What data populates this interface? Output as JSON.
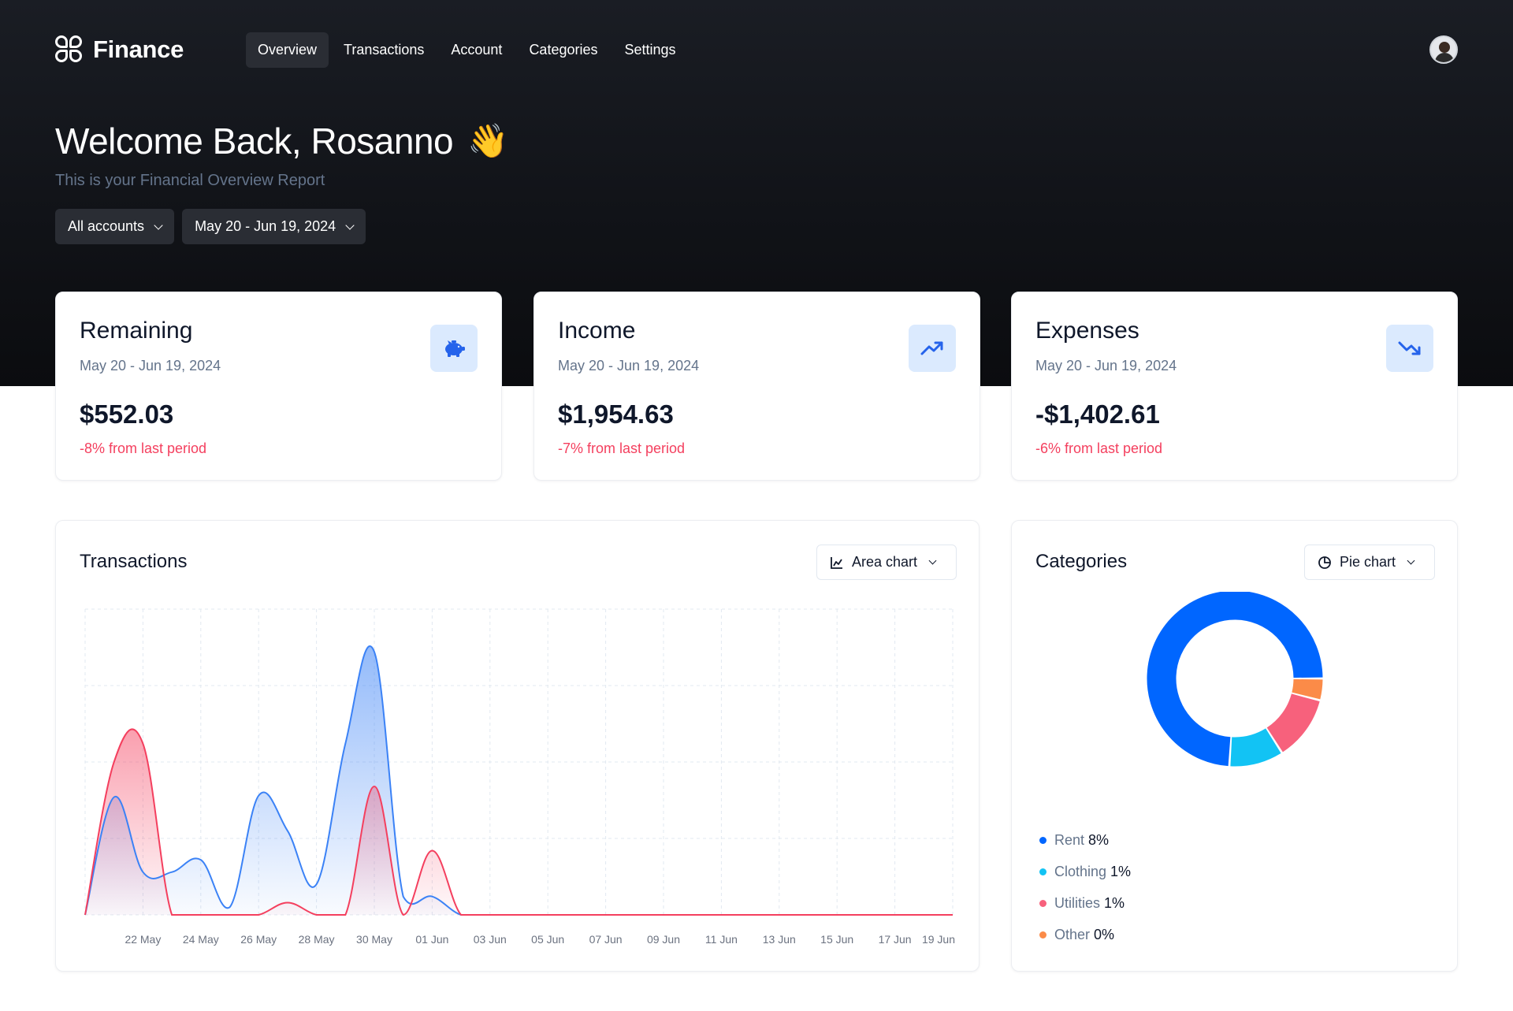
{
  "app": {
    "name": "Finance"
  },
  "nav": {
    "items": [
      {
        "label": "Overview",
        "active": true
      },
      {
        "label": "Transactions",
        "active": false
      },
      {
        "label": "Account",
        "active": false
      },
      {
        "label": "Categories",
        "active": false
      },
      {
        "label": "Settings",
        "active": false
      }
    ]
  },
  "header": {
    "title": "Welcome Back, Rosanno",
    "emoji": "👋",
    "subtitle": "This is your Financial Overview Report"
  },
  "filters": {
    "account": "All accounts",
    "date_range": "May 20 - Jun 19, 2024"
  },
  "stats": [
    {
      "title": "Remaining",
      "range": "May 20 - Jun 19, 2024",
      "value": "$552.03",
      "change": "-8% from last period",
      "icon": "piggy-bank-icon"
    },
    {
      "title": "Income",
      "range": "May 20 - Jun 19, 2024",
      "value": "$1,954.63",
      "change": "-7% from last period",
      "icon": "trending-up-icon"
    },
    {
      "title": "Expenses",
      "range": "May 20 - Jun 19, 2024",
      "value": "-$1,402.61",
      "change": "-6% from last period",
      "icon": "trending-down-icon"
    }
  ],
  "transactions_panel": {
    "title": "Transactions",
    "chart_type_label": "Area chart"
  },
  "categories_panel": {
    "title": "Categories",
    "chart_type_label": "Pie chart"
  },
  "colors": {
    "income": "#3b82f6",
    "expense": "#f43f5e",
    "change_negative": "#f43f5e",
    "icon_bg": "#dbeafe"
  },
  "chart_data": [
    {
      "type": "area",
      "tick_labels": [
        "22 May",
        "24 May",
        "26 May",
        "28 May",
        "30 May",
        "01 Jun",
        "03 Jun",
        "05 Jun",
        "07 Jun",
        "09 Jun",
        "11 Jun",
        "13 Jun",
        "15 Jun",
        "17 Jun",
        "19 Jun"
      ],
      "x": [
        "20 May",
        "21 May",
        "22 May",
        "23 May",
        "24 May",
        "25 May",
        "26 May",
        "27 May",
        "28 May",
        "29 May",
        "30 May",
        "31 May",
        "01 Jun",
        "02 Jun",
        "03 Jun",
        "04 Jun",
        "05 Jun",
        "06 Jun",
        "07 Jun",
        "08 Jun",
        "09 Jun",
        "10 Jun",
        "11 Jun",
        "12 Jun",
        "13 Jun",
        "14 Jun",
        "15 Jun",
        "16 Jun",
        "17 Jun",
        "18 Jun",
        "19 Jun"
      ],
      "series": [
        {
          "color": "#3b82f6",
          "values": [
            0,
            385,
            140,
            140,
            180,
            25,
            390,
            275,
            100,
            560,
            860,
            60,
            60,
            0,
            0,
            0,
            0,
            0,
            0,
            0,
            0,
            0,
            0,
            0,
            0,
            0,
            0,
            0,
            0,
            0,
            0
          ]
        },
        {
          "color": "#f43f5e",
          "values": [
            0,
            500,
            560,
            0,
            0,
            0,
            0,
            40,
            0,
            0,
            420,
            0,
            210,
            0,
            0,
            0,
            0,
            0,
            0,
            0,
            0,
            0,
            0,
            0,
            0,
            0,
            0,
            0,
            0,
            0,
            0
          ]
        }
      ],
      "ylim": [
        0,
        1000
      ],
      "grid": true
    },
    {
      "type": "pie",
      "donut": true,
      "categories": [
        "Rent",
        "Clothing",
        "Utilities",
        "Other"
      ],
      "legend_values": [
        "8%",
        "1%",
        "1%",
        "0%"
      ],
      "slice_shares": [
        74,
        10,
        12,
        4
      ],
      "colors": [
        "#0066ff",
        "#12c3f4",
        "#f7617c",
        "#fb8b48"
      ]
    }
  ]
}
